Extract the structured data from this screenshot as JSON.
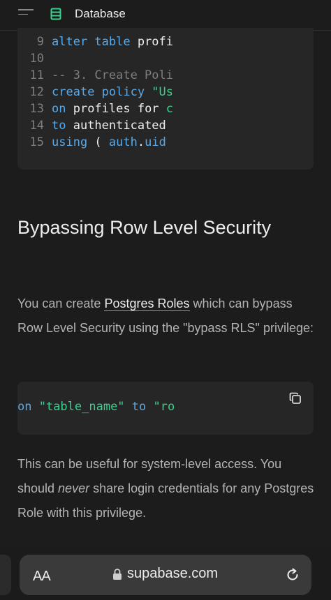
{
  "header": {
    "title": "Database",
    "menu_icon": "hamburger-icon",
    "section_icon": "database-icon"
  },
  "code_block_1": {
    "lines": [
      {
        "num": "9",
        "tokens": [
          {
            "t": "kw",
            "v": "alter table "
          },
          {
            "t": "txt",
            "v": "profi"
          }
        ]
      },
      {
        "num": "10",
        "tokens": []
      },
      {
        "num": "11",
        "tokens": [
          {
            "t": "cmt",
            "v": "-- 3. Create Poli"
          }
        ]
      },
      {
        "num": "12",
        "tokens": [
          {
            "t": "kw",
            "v": "create policy "
          },
          {
            "t": "str",
            "v": "\"Us"
          }
        ]
      },
      {
        "num": "13",
        "tokens": [
          {
            "t": "kw",
            "v": "on "
          },
          {
            "t": "txt",
            "v": "profiles for "
          },
          {
            "t": "str",
            "v": "c"
          }
        ]
      },
      {
        "num": "14",
        "tokens": [
          {
            "t": "kw",
            "v": "to "
          },
          {
            "t": "txt",
            "v": "authenticated"
          }
        ]
      },
      {
        "num": "15",
        "tokens": [
          {
            "t": "kw",
            "v": "using "
          },
          {
            "t": "txt",
            "v": "( "
          },
          {
            "t": "kw",
            "v": "auth"
          },
          {
            "t": "txt",
            "v": "."
          },
          {
            "t": "kw",
            "v": "uid"
          }
        ]
      }
    ]
  },
  "section": {
    "heading": "Bypassing Row Level Security",
    "para1_before": "You can create ",
    "para1_link": "Postgres Roles",
    "para1_after": " which can bypass Row Level Security using the \"bypass RLS\" privilege:"
  },
  "code_block_2": {
    "tokens": [
      {
        "t": "kw",
        "v": "on "
      },
      {
        "t": "str",
        "v": "\"table_name\" "
      },
      {
        "t": "kw",
        "v": "to "
      },
      {
        "t": "str",
        "v": "\"ro"
      }
    ],
    "copy_icon": "copy-icon"
  },
  "para2": {
    "before": "This can be useful for system-level access. You should ",
    "emphasis": "never",
    "after": " share login credentials for any Postgres Role with this privilege."
  },
  "browser": {
    "text_size_button": "AA",
    "url": "supabase.com",
    "lock_icon": "lock-icon",
    "reload_icon": "reload-icon"
  }
}
